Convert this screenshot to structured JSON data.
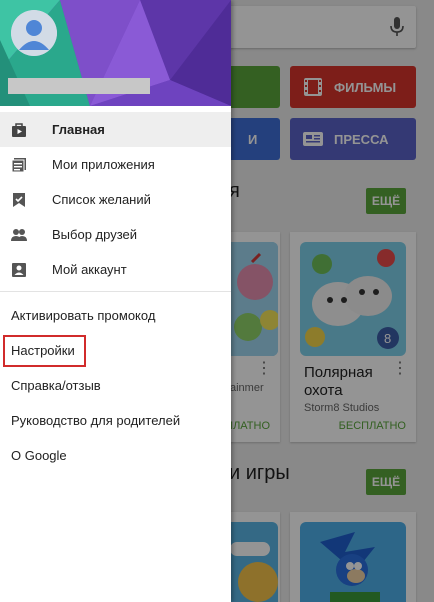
{
  "store": {
    "search_placeholder": "",
    "categories": [
      {
        "label": "",
        "color": "#5aa63c"
      },
      {
        "label": "ФИЛЬМЫ",
        "color": "#d8342c"
      },
      {
        "label": "И",
        "color": "#3f6ed8"
      },
      {
        "label": "ПРЕССА",
        "color": "#5a63c9"
      }
    ],
    "section1": {
      "title": "я",
      "more_label": "ЕЩЁ"
    },
    "section2": {
      "title": "и игры",
      "more_label": "ЕЩЁ"
    },
    "cards": [
      {
        "title": "",
        "developer": "ainmer",
        "price": "ПЛАТНО"
      },
      {
        "title": "Полярная охота",
        "developer": "Storm8 Studios",
        "price": "БЕСПЛАТНО"
      }
    ]
  },
  "drawer": {
    "nav_items": [
      {
        "label": "Главная",
        "icon": "store-icon"
      },
      {
        "label": "Мои приложения",
        "icon": "apps-icon"
      },
      {
        "label": "Список желаний",
        "icon": "wishlist-icon"
      },
      {
        "label": "Выбор друзей",
        "icon": "people-icon"
      },
      {
        "label": "Мой аккаунт",
        "icon": "account-icon"
      }
    ],
    "text_items": [
      "Активировать промокод",
      "Настройки",
      "Справка/отзыв",
      "Руководство для родителей",
      "О Google"
    ]
  },
  "colors": {
    "highlight": "#d12b2b",
    "accent_green": "#5aa63c"
  }
}
